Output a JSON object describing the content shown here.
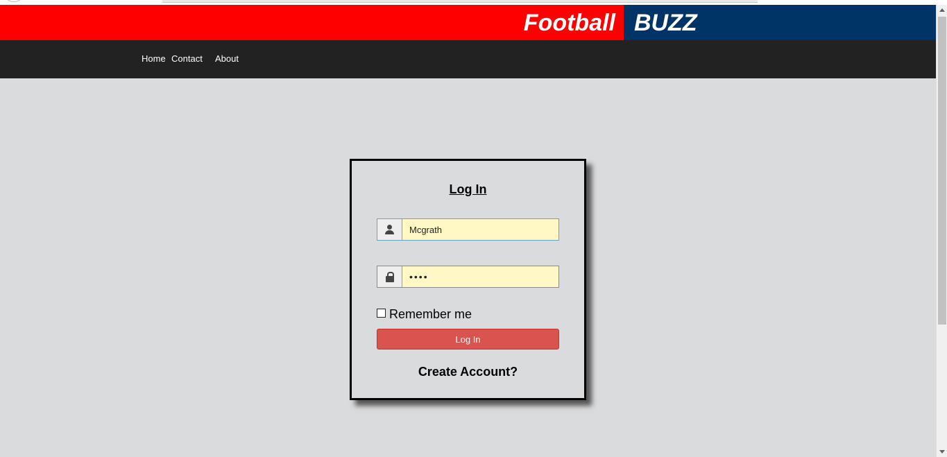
{
  "brand": {
    "left_text": "Football",
    "right_text": "BUZZ",
    "red_color": "#ff0000",
    "blue_color": "#003366"
  },
  "nav": {
    "items": [
      {
        "label": "Home"
      },
      {
        "label": "Contact"
      },
      {
        "label": "About"
      }
    ]
  },
  "login": {
    "title": "Log In",
    "username_value": "Mcgrath",
    "username_icon": "user-icon",
    "password_value": "••••",
    "password_icon": "lock-icon",
    "remember_label": "Remember me",
    "remember_checked": false,
    "submit_label": "Log In",
    "submit_color": "#d9534f",
    "create_account_label": "Create Account?"
  }
}
